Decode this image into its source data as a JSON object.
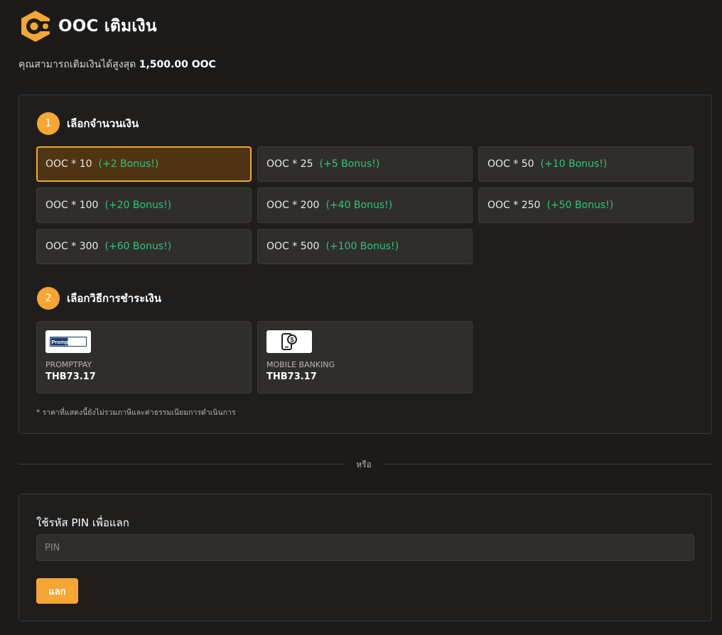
{
  "header": {
    "title": "OOC เติมเงิน",
    "subtitle_prefix": "คุณสามารถเติมเงินได้สูงสุด",
    "max_amount": "1,500.00 OOC",
    "logo_icon": "ooc-coin-logo-icon"
  },
  "colors": {
    "accent": "#f5a633",
    "bonus": "#2cc481",
    "background": "#1c1b1a",
    "card": "#302e2b",
    "selected_bg": "#4f3514"
  },
  "step1": {
    "number": "1",
    "label": "เลือกจำนวนเงิน",
    "selected_index": 0,
    "options": [
      {
        "amount": "OOC * 10",
        "bonus": "(+2 Bonus!)"
      },
      {
        "amount": "OOC * 25",
        "bonus": "(+5 Bonus!)"
      },
      {
        "amount": "OOC * 50",
        "bonus": "(+10 Bonus!)"
      },
      {
        "amount": "OOC * 100",
        "bonus": "(+20 Bonus!)"
      },
      {
        "amount": "OOC * 200",
        "bonus": "(+40 Bonus!)"
      },
      {
        "amount": "OOC * 250",
        "bonus": "(+50 Bonus!)"
      },
      {
        "amount": "OOC * 300",
        "bonus": "(+60 Bonus!)"
      },
      {
        "amount": "OOC * 500",
        "bonus": "(+100 Bonus!)"
      }
    ]
  },
  "step2": {
    "number": "2",
    "label": "เลือกวิธีการชำระเงิน",
    "methods": [
      {
        "name": "PROMPTPAY",
        "price": "THB73.17",
        "logo_text": "PromptPay",
        "icon": "promptpay-logo-icon"
      },
      {
        "name": "MOBILE BANKING",
        "price": "THB73.17",
        "icon": "mobile-banking-icon"
      }
    ],
    "footnote": "* ราคาที่แสดงนี้ยังไม่รวมภาษีและค่าธรรมเนียมการดำเนินการ"
  },
  "divider": {
    "text": "หรือ"
  },
  "pin": {
    "label": "ใช้รหัส PIN เพื่อแลก",
    "placeholder": "PIN",
    "value": "",
    "button_label": "แลก"
  }
}
